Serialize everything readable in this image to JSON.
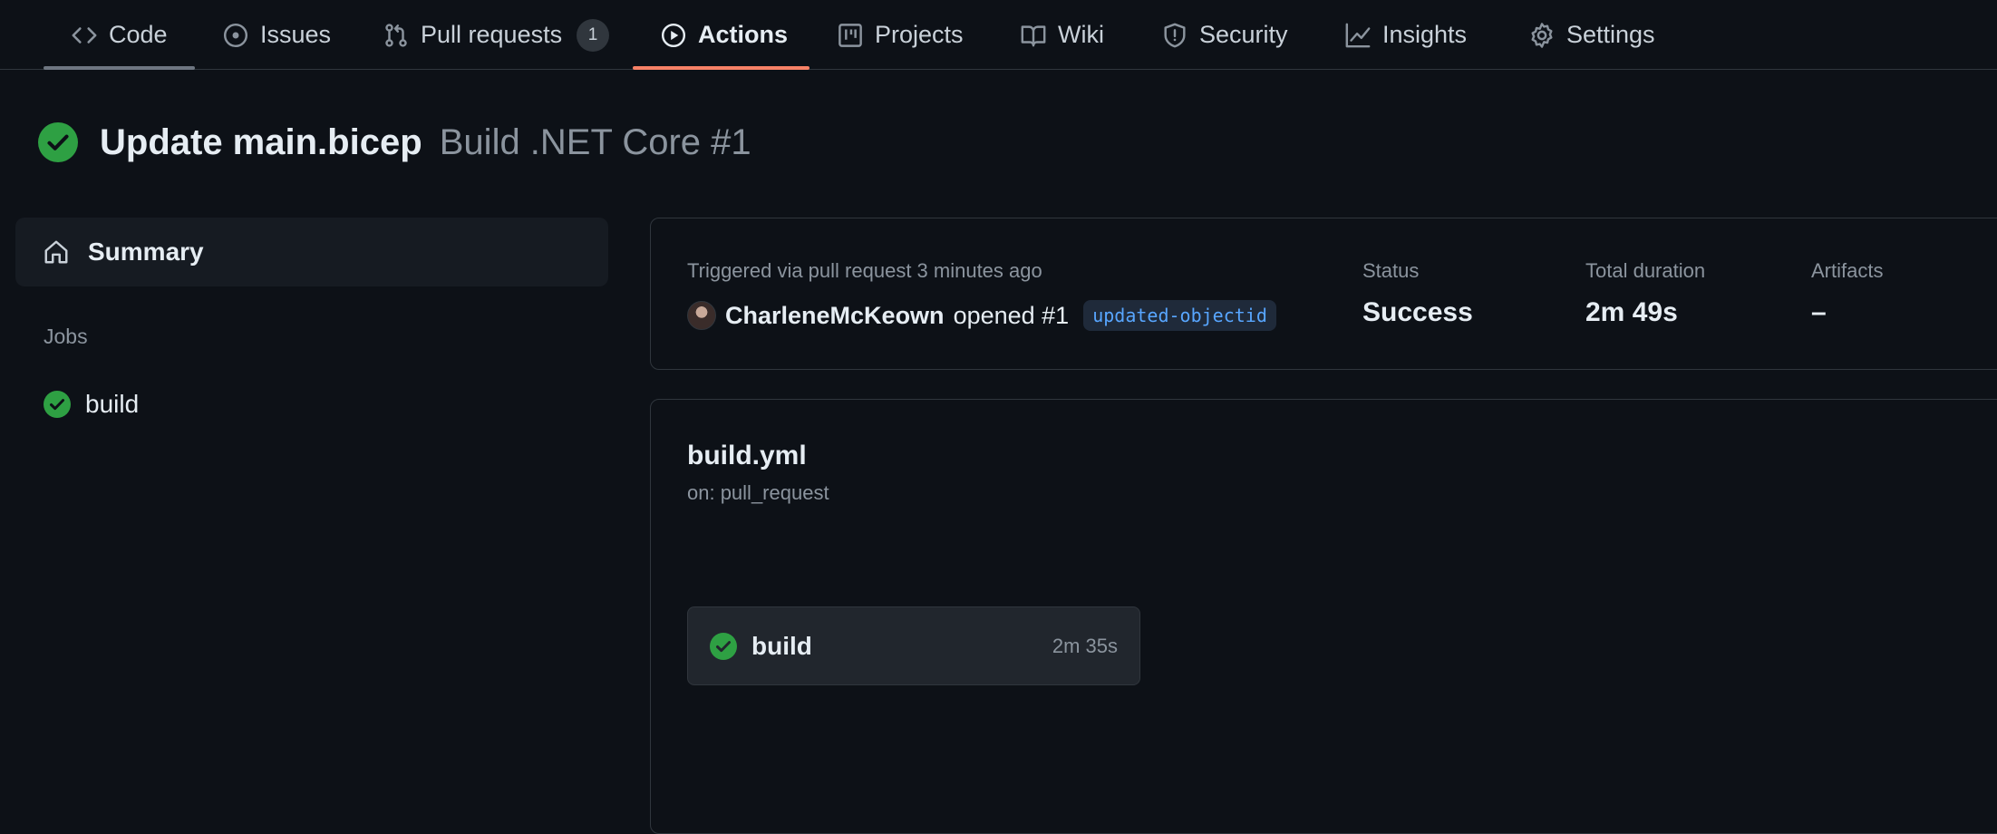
{
  "nav": {
    "tabs": [
      {
        "label": "Code",
        "icon": "code-icon"
      },
      {
        "label": "Issues",
        "icon": "issue-opened-icon"
      },
      {
        "label": "Pull requests",
        "icon": "git-pull-request-icon",
        "counter": "1"
      },
      {
        "label": "Actions",
        "icon": "play-icon",
        "selected": true
      },
      {
        "label": "Projects",
        "icon": "table-icon"
      },
      {
        "label": "Wiki",
        "icon": "book-icon"
      },
      {
        "label": "Security",
        "icon": "shield-icon"
      },
      {
        "label": "Insights",
        "icon": "graph-icon"
      },
      {
        "label": "Settings",
        "icon": "gear-icon"
      }
    ]
  },
  "run": {
    "title": "Update main.bicep",
    "workflow_run": "Build .NET Core #1",
    "status_icon": "check-circle-fill-icon"
  },
  "sidebar": {
    "summary_label": "Summary",
    "jobs_heading": "Jobs",
    "jobs": [
      {
        "label": "build",
        "status": "success"
      }
    ]
  },
  "info": {
    "trigger": "Triggered via pull request 3 minutes ago",
    "author": "CharleneMcKeown",
    "action": "opened #1",
    "branch": "updated-objectid",
    "status_label": "Status",
    "status_value": "Success",
    "duration_label": "Total duration",
    "duration_value": "2m 49s",
    "artifacts_label": "Artifacts",
    "artifacts_value": "–"
  },
  "workflow": {
    "file": "build.yml",
    "on": "on: pull_request",
    "job": {
      "name": "build",
      "duration": "2m 35s"
    }
  },
  "colors": {
    "background": "#0d1117",
    "accent_underline": "#f78166",
    "success": "#2ea043",
    "link": "#58a6ff"
  }
}
